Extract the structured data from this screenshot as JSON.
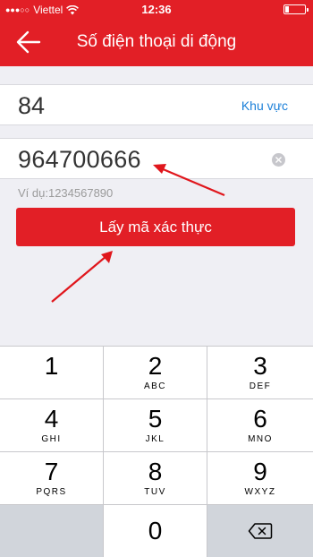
{
  "status_bar": {
    "carrier": "Viettel",
    "time": "12:36"
  },
  "nav": {
    "title": "Số điện thoại di động"
  },
  "country": {
    "code": "84",
    "region_label": "Khu vực"
  },
  "phone": {
    "value": "964700666"
  },
  "example": "Ví dụ:1234567890",
  "get_code_button": "Lấy mã xác thực",
  "keypad": {
    "keys": [
      {
        "digit": "1",
        "letters": ""
      },
      {
        "digit": "2",
        "letters": "ABC"
      },
      {
        "digit": "3",
        "letters": "DEF"
      },
      {
        "digit": "4",
        "letters": "GHI"
      },
      {
        "digit": "5",
        "letters": "JKL"
      },
      {
        "digit": "6",
        "letters": "MNO"
      },
      {
        "digit": "7",
        "letters": "PQRS"
      },
      {
        "digit": "8",
        "letters": "TUV"
      },
      {
        "digit": "9",
        "letters": "WXYZ"
      },
      {
        "digit": "0",
        "letters": ""
      }
    ]
  },
  "colors": {
    "brand_red": "#e21f26",
    "link_blue": "#1a7fd8",
    "annotation_arrow": "#e0161c"
  }
}
